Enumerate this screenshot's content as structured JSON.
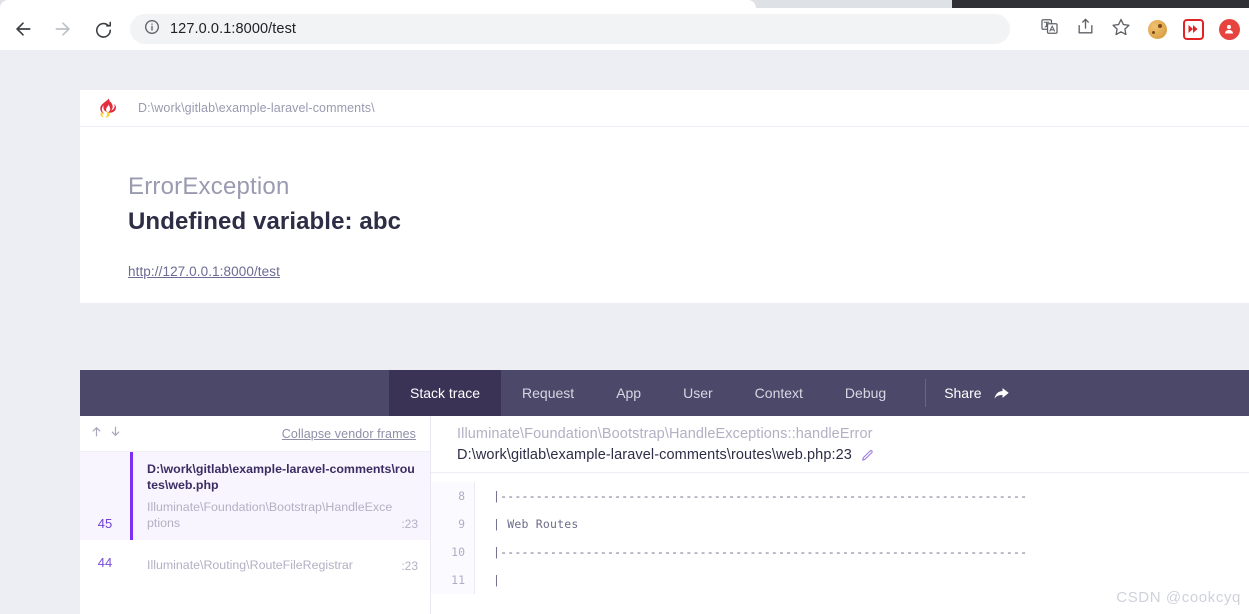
{
  "browser": {
    "back_label": "Back",
    "forward_label": "Forward",
    "reload_label": "Reload",
    "site_info_label": "Site information",
    "url_scheme": "127.0.0.1:8000",
    "url_path": "/test",
    "url_full": "127.0.0.1:8000/test",
    "icons": {
      "back": "back-arrow-icon",
      "forward": "forward-arrow-icon",
      "reload": "reload-icon",
      "info": "info-circle-icon",
      "translate": "translate-icon",
      "share": "share-icon",
      "bookmark": "star-icon",
      "cookie_extension": "cookie-extension-icon",
      "video_extension": "fast-forward-extension-icon",
      "profile": "profile-avatar-icon"
    }
  },
  "error_card": {
    "logo_name": "ignition-flame-logo",
    "app_path": "D:\\work\\gitlab\\example-laravel-comments\\",
    "exception_class": "ErrorException",
    "exception_message": "Undefined variable: abc",
    "request_url": "http://127.0.0.1:8000/test"
  },
  "tabbar": {
    "tabs": [
      {
        "label": "Stack trace",
        "active": true
      },
      {
        "label": "Request",
        "active": false
      },
      {
        "label": "App",
        "active": false
      },
      {
        "label": "User",
        "active": false
      },
      {
        "label": "Context",
        "active": false
      },
      {
        "label": "Debug",
        "active": false
      }
    ],
    "share_label": "Share",
    "share_icon": "share-arrow-icon"
  },
  "stack_trace": {
    "sort_up_icon": "arrow-up-icon",
    "sort_down_icon": "arrow-down-icon",
    "collapse_label": "Collapse vendor frames",
    "frames": [
      {
        "number": "45",
        "file": "D:\\work\\gitlab\\example-laravel-comments\\routes\\web.php",
        "class": "Illuminate\\Foundation\\Bootstrap\\HandleExceptions",
        "line": ":23",
        "selected": true
      },
      {
        "number": "44",
        "file": "",
        "class": "Illuminate\\Routing\\RouteFileRegistrar",
        "line": ":23",
        "selected": false
      }
    ]
  },
  "code_panel": {
    "class_name": "Illuminate\\Foundation\\Bootstrap\\HandleExceptions::handleError",
    "file_path": "D:\\work\\gitlab\\example-laravel-comments\\routes\\web.php:23",
    "edit_icon": "pencil-icon",
    "lines": [
      {
        "number": "8",
        "code": "|--------------------------------------------------------------------------"
      },
      {
        "number": "9",
        "code": "| Web Routes"
      },
      {
        "number": "10",
        "code": "|--------------------------------------------------------------------------"
      },
      {
        "number": "11",
        "code": "|"
      }
    ]
  },
  "watermark": {
    "text": "CSDN @cookcyq"
  },
  "colors": {
    "page_bg": "#eceef3",
    "tabbar_bg": "#4c4869",
    "tab_active_bg": "#3b3356",
    "accent_purple": "#7b2ff7",
    "frame_selected_bg": "#f9f5fe",
    "title_dark": "#2d2d46",
    "muted": "#9a9ab0"
  }
}
